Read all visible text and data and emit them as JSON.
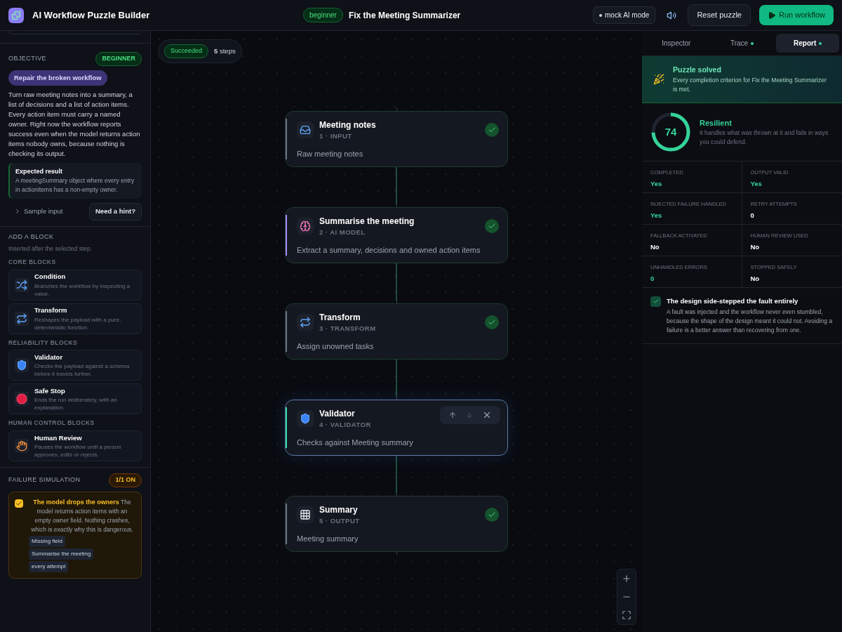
{
  "app": {
    "title": "AI Workflow Puzzle Builder"
  },
  "header": {
    "level": "beginner",
    "puzzle_title": "Fix the Meeting Summarizer",
    "mode": "mock AI mode",
    "reset": "Reset puzzle",
    "run": "Run workflow"
  },
  "objective": {
    "label": "OBJECTIVE",
    "difficulty": "BEGINNER",
    "goal": "Repair the broken workflow",
    "description": "Turn raw meeting notes into a summary, a list of decisions and a list of action items. Every action item must carry a named owner. Right now the workflow reports success even when the model returns action items nobody owns, because nothing is checking its output.",
    "expected_title": "Expected result",
    "expected_text": "A meetingSummary object where every entry in actionItems has a non-empty owner.",
    "sample_input": "Sample input",
    "expanded": false,
    "hint": "Need a hint?"
  },
  "add_block": {
    "title": "ADD A BLOCK",
    "note": "Inserted after the selected step.",
    "groups": [
      {
        "label": "CORE BLOCKS",
        "blocks": [
          {
            "kind": "condition",
            "name": "Condition",
            "description": "Branches the workflow by inspecting a value."
          },
          {
            "kind": "transform",
            "name": "Transform",
            "description": "Reshapes the payload with a pure, deterministic function."
          }
        ]
      },
      {
        "label": "RELIABILITY BLOCKS",
        "blocks": [
          {
            "kind": "validator",
            "name": "Validator",
            "description": "Checks the payload against a schema before it travels further."
          },
          {
            "kind": "safe_stop",
            "name": "Safe Stop",
            "description": "Ends the run deliberately, with an explanation."
          }
        ]
      },
      {
        "label": "HUMAN CONTROL BLOCKS",
        "blocks": [
          {
            "kind": "human_review",
            "name": "Human Review",
            "description": "Pauses the workflow until a person approves, edits or rejects."
          }
        ]
      }
    ]
  },
  "failure_simulation": {
    "title": "FAILURE SIMULATION",
    "count": "1/1 ON",
    "scenarios": [
      {
        "checked": true,
        "title": "The model drops the owners",
        "description": "The model returns action items with an empty owner field. Nothing crashes, which is exactly why this is dangerous.",
        "tags": [
          "Missing field",
          "Summarise the meeting",
          "every attempt"
        ]
      }
    ]
  },
  "canvas": {
    "status": "Succeeded",
    "steps": "**5** steps",
    "nodes": [
      {
        "kind": "input",
        "title": "Meeting notes",
        "subtitle": "1 · INPUT",
        "description": "Raw meeting notes",
        "passed": true,
        "selected": false
      },
      {
        "kind": "ai_model",
        "title": "Summarise the meeting",
        "subtitle": "2 · AI MODEL",
        "description": "Extract a summary, decisions and owned action items",
        "passed": true,
        "selected": false
      },
      {
        "kind": "transform",
        "title": "Transform",
        "subtitle": "3 · TRANSFORM",
        "description": "Assign unowned tasks",
        "passed": true,
        "selected": false
      },
      {
        "kind": "validator",
        "title": "Validator",
        "subtitle": "4 · VALIDATOR",
        "description": "Checks against Meeting summary",
        "passed": false,
        "selected": true
      },
      {
        "kind": "output",
        "title": "Summary",
        "subtitle": "5 · OUTPUT",
        "description": "Meeting summary",
        "passed": true,
        "selected": false
      }
    ]
  },
  "panel": {
    "tabs": [
      {
        "label": "Inspector",
        "selected": false,
        "indicator": false
      },
      {
        "label": "Trace",
        "selected": false,
        "indicator": true
      },
      {
        "label": "Report",
        "selected": true,
        "indicator": true
      }
    ],
    "banner": {
      "title": "Puzzle solved",
      "text": "Every completion criterion for Fix the Meeting Summarizer is met."
    },
    "score": {
      "value": "74",
      "level": 0.74,
      "label": "Resilient",
      "text": "It handles what was thrown at it and fails in ways you could defend."
    },
    "metrics": [
      {
        "label": "COMPLETED",
        "value": "Yes",
        "good": true
      },
      {
        "label": "OUTPUT VALID",
        "value": "Yes",
        "good": true
      },
      {
        "label": "INJECTED FAILURE HANDLED",
        "value": "Yes",
        "good": true
      },
      {
        "label": "RETRY ATTEMPTS",
        "value": "0",
        "good": false
      },
      {
        "label": "FALLBACK ACTIVATED",
        "value": "No",
        "good": false
      },
      {
        "label": "HUMAN REVIEW USED",
        "value": "No",
        "good": false
      },
      {
        "label": "UNHANDLED ERRORS",
        "value": "0",
        "good": true
      },
      {
        "label": "STOPPED SAFELY",
        "value": "No",
        "good": false
      }
    ],
    "insight": {
      "checked": true,
      "title": "The design side-stepped the fault entirely",
      "text": "A fault was injected and the workflow never even stumbled, because the shape of the design meant it could not. Avoiding a failure is a better answer than recovering from one."
    }
  }
}
